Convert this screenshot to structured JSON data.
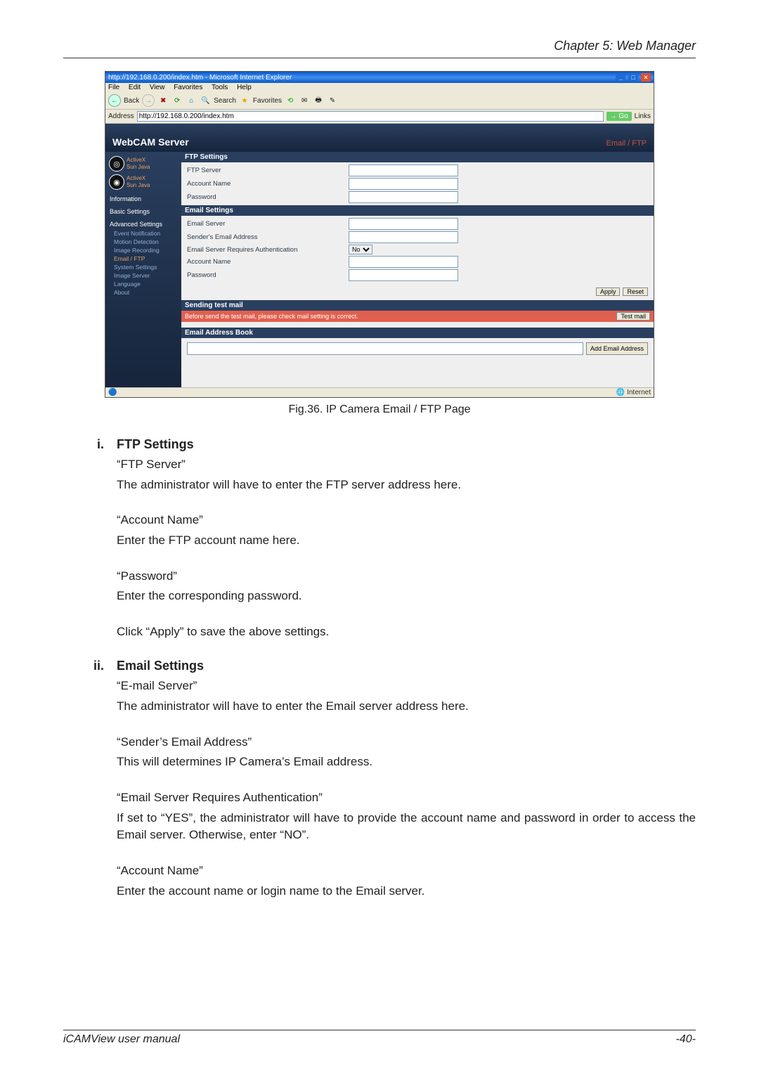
{
  "header": {
    "chapter": "Chapter 5: Web Manager"
  },
  "ie": {
    "title": "http://192.168.0.200/index.htm - Microsoft Internet Explorer",
    "menus": [
      "File",
      "Edit",
      "View",
      "Favorites",
      "Tools",
      "Help"
    ],
    "back": "Back",
    "search": "Search",
    "favorites": "Favorites",
    "address_label": "Address",
    "address_value": "http://192.168.0.200/index.htm",
    "go": "Go",
    "links": "Links",
    "status_zone": "Internet"
  },
  "webcam": {
    "title": "WebCAM Server",
    "crumb": "Email / FTP",
    "cam_links": {
      "activex": "ActiveX",
      "sunjava": "Sun Java"
    },
    "nav": {
      "info": "Information",
      "basic": "Basic Settings",
      "advanced": "Advanced Settings",
      "sub": {
        "event": "Event Notification",
        "motion": "Motion Detection",
        "imgrec": "Image Recording",
        "email": "Email / FTP",
        "sys": "System Settings",
        "imgsrv": "Image Server",
        "lang": "Language",
        "about": "About"
      }
    },
    "ftp": {
      "title": "FTP Settings",
      "server": "FTP Server",
      "account": "Account Name",
      "password": "Password"
    },
    "email": {
      "title": "Email Settings",
      "server": "Email Server",
      "sender": "Sender's Email Address",
      "auth": "Email Server Requires Authentication",
      "auth_value": "No",
      "account": "Account Name",
      "password": "Password"
    },
    "buttons": {
      "apply": "Apply",
      "reset": "Reset",
      "testmail": "Test mail",
      "add_email": "Add Email Address"
    },
    "sendtest": {
      "title": "Sending test mail",
      "note": "Before send the test mail, please check mail setting is correct."
    },
    "book": {
      "title": "Email Address Book"
    }
  },
  "caption": "Fig.36.  IP Camera Email / FTP Page",
  "section1": {
    "num": "i.",
    "title": "FTP Settings",
    "p1a": "“FTP Server”",
    "p1b": "The administrator will have to enter the FTP server address here.",
    "p2a": "“Account Name”",
    "p2b": "Enter the FTP account name here.",
    "p3a": "“Password”",
    "p3b": "Enter the corresponding password.",
    "p4": "Click “Apply” to save the above settings."
  },
  "section2": {
    "num": "ii.",
    "title": "Email Settings",
    "p1a": "“E-mail Server”",
    "p1b": "The administrator will have to enter the Email server address here.",
    "p2a": "“Sender’s Email Address”",
    "p2b": "This will determines IP Camera’s Email address.",
    "p3a": "“Email Server Requires Authentication”",
    "p3b": "If set to “YES”, the administrator will have to provide the account name and password in order to access the Email server.   Otherwise, enter “NO”.",
    "p4a": "“Account Name”",
    "p4b": "Enter the account name or login name to the Email server."
  },
  "footer": {
    "left": "iCAMView  user  manual",
    "right": "-40-"
  }
}
